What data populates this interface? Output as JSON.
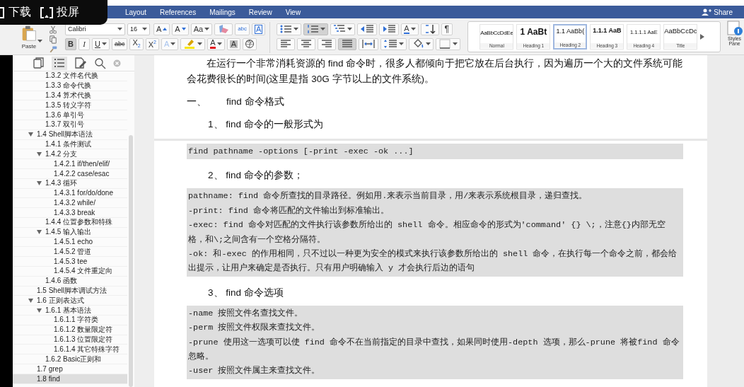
{
  "overlay": [
    {
      "kind": "download",
      "label": "下载"
    },
    {
      "kind": "cast",
      "label": "投屏"
    }
  ],
  "ribbon_tabs": [
    {
      "label": "Layout",
      "selected": false
    },
    {
      "label": "References",
      "selected": false
    },
    {
      "label": "Mailings",
      "selected": false
    },
    {
      "label": "Review",
      "selected": false
    },
    {
      "label": "View",
      "selected": false
    }
  ],
  "share": {
    "label": "Share"
  },
  "clipboard": {
    "paste_label": "Paste",
    "tools": [
      {
        "kind": "cut"
      },
      {
        "kind": "copy"
      },
      {
        "kind": "painter"
      }
    ]
  },
  "font": {
    "name": "Calibri",
    "size": "16",
    "row1": [
      {
        "kind": "grow",
        "label": "A",
        "on": false
      },
      {
        "kind": "shrink",
        "label": "A",
        "on": false
      },
      {
        "kind": "case",
        "label": "Aa",
        "on": false,
        "dropdown": true
      },
      {
        "kind": "clear",
        "on": false
      },
      {
        "kind": "spell",
        "label": "abc",
        "on": false
      },
      {
        "kind": "textbox",
        "label": "A",
        "on": false
      }
    ],
    "row2": [
      {
        "kind": "bold",
        "label": "B",
        "on": true
      },
      {
        "kind": "italic",
        "label": "I",
        "on": false
      },
      {
        "kind": "underline",
        "label": "U",
        "on": false,
        "dropdown": true
      },
      {
        "kind": "strike",
        "label": "abc",
        "on": false
      },
      {
        "kind": "sub",
        "label": "X$_{2}$",
        "on": false
      },
      {
        "kind": "sup",
        "label": "X$^{2}$",
        "on": false
      },
      {
        "kind": "effects",
        "label": "A",
        "on": false,
        "dropdown": true
      },
      {
        "kind": "highlight",
        "on": false,
        "dropdown": true
      },
      {
        "kind": "fontcolor",
        "label": "A",
        "on": false,
        "dropdown": true
      },
      {
        "kind": "shade",
        "label": "A",
        "on": false
      },
      {
        "kind": "enclose",
        "label": "字",
        "on": false
      }
    ]
  },
  "paragraph": {
    "row1": [
      {
        "kind": "bullets",
        "on": false,
        "dropdown": true
      },
      {
        "kind": "numbering",
        "on": true,
        "dropdown": true
      },
      {
        "kind": "multilevel",
        "on": false,
        "dropdown": true
      },
      {
        "kind": "outdent",
        "on": false
      },
      {
        "kind": "indent",
        "on": false
      },
      {
        "kind": "direction",
        "label": "A",
        "on": false,
        "dropdown": true
      },
      {
        "kind": "sort",
        "on": false
      },
      {
        "kind": "pilcrow",
        "label": "¶",
        "on": false
      }
    ],
    "row2": [
      {
        "kind": "left",
        "on": false
      },
      {
        "kind": "center",
        "on": false
      },
      {
        "kind": "right",
        "on": false
      },
      {
        "kind": "justify",
        "on": true
      },
      {
        "kind": "distribute",
        "on": false
      },
      {
        "kind": "spacing",
        "on": false,
        "dropdown": true
      },
      {
        "kind": "shading",
        "on": false,
        "dropdown": true
      },
      {
        "kind": "borders",
        "on": false,
        "dropdown": true
      }
    ]
  },
  "styles": [
    {
      "preview": "AaBbCcDdEe",
      "name": "Normal",
      "kind": "normal",
      "selected": false
    },
    {
      "preview": "1 AaBt",
      "name": "Heading 1",
      "kind": "h1",
      "selected": false
    },
    {
      "preview": "1.1 AaBb(",
      "name": "Heading 2",
      "kind": "h2",
      "selected": true
    },
    {
      "preview": "1.1.1 AaB",
      "name": "Heading 3",
      "kind": "h3",
      "selected": false
    },
    {
      "preview": "1.1.1.1 AaE",
      "name": "Heading 4",
      "kind": "h4",
      "selected": false
    },
    {
      "preview": "AaBbCcDc",
      "name": "Title",
      "kind": "title",
      "selected": false
    }
  ],
  "styles_pane": {
    "label": "Styles Pane"
  },
  "nav_pane": {
    "tabs": [
      {
        "kind": "thumbnails",
        "selected": false
      },
      {
        "kind": "outline",
        "selected": true
      },
      {
        "kind": "pages",
        "selected": false
      },
      {
        "kind": "search",
        "selected": false
      }
    ],
    "items": [
      {
        "children": [
          {
            "label": "1.3.2 文件名代换",
            "selected": false
          },
          {
            "label": "1.3.3 命令代换",
            "selected": false
          },
          {
            "label": "1.3.4 算术代换",
            "selected": false
          },
          {
            "label": "1.3.5 转义字符",
            "selected": false
          },
          {
            "label": "1.3.6 单引号",
            "selected": false
          },
          {
            "label": "1.3.7 双引号",
            "selected": false
          }
        ]
      },
      {
        "label": "1.4 Shell脚本语法",
        "selected": false,
        "expanded": true,
        "children": [
          {
            "label": "1.4.1 条件测试",
            "selected": false
          },
          {
            "label": "1.4.2 分支",
            "selected": false,
            "expanded": true,
            "children": [
              {
                "label": "1.4.2.1 if/then/elif/",
                "selected": false
              },
              {
                "label": "1.4.2.2 case/esac",
                "selected": false
              }
            ]
          },
          {
            "label": "1.4.3 循环",
            "selected": false,
            "expanded": true,
            "children": [
              {
                "label": "1.4.3.1 for/do/done",
                "selected": false
              },
              {
                "label": "1.4.3.2 while/",
                "selected": false
              },
              {
                "label": "1.4.3.3 break",
                "selected": false
              }
            ]
          },
          {
            "label": "1.4.4 位置参数和特殊",
            "selected": false
          },
          {
            "label": "1.4.5 输入输出",
            "selected": false,
            "expanded": true,
            "children": [
              {
                "label": "1.4.5.1 echo",
                "selected": false
              },
              {
                "label": "1.4.5.2 管道",
                "selected": false
              },
              {
                "label": "1.4.5.3 tee",
                "selected": false
              },
              {
                "label": "1.4.5.4 文件重定向",
                "selected": false
              }
            ]
          },
          {
            "label": "1.4.6 函数",
            "selected": false
          }
        ]
      },
      {
        "label": "1.5 Shell脚本调试方法",
        "selected": false
      },
      {
        "label": "1.6 正则表达式",
        "selected": false,
        "expanded": true,
        "children": [
          {
            "label": "1.6.1 基本语法",
            "selected": false,
            "expanded": true,
            "children": [
              {
                "label": "1.6.1.1 字符类",
                "selected": false
              },
              {
                "label": "1.6.1.2 数量限定符",
                "selected": false
              },
              {
                "label": "1.6.1.3 位置限定符",
                "selected": false
              },
              {
                "label": "1.6.1.4 其它特殊字符",
                "selected": false
              }
            ]
          },
          {
            "label": "1.6.2 Basic正则和",
            "selected": false
          }
        ]
      },
      {
        "label": "1.7 grep",
        "selected": false
      },
      {
        "label": "1.8 find",
        "selected": true
      }
    ]
  },
  "document": {
    "blocks": [
      {
        "kind": "para",
        "text": "在运行一个非常消耗资源的 find 命令时，很多人都倾向于把它放在后台执行，因为遍历一个大的文件系统可能会花费很长的时间(这里是指 30G 字节以上的文件系统)。"
      },
      {
        "kind": "heading1",
        "number": "一、",
        "text": "find  命令格式"
      },
      {
        "kind": "heading2",
        "text": "1、 find 命令的一般形式为"
      },
      {
        "kind": "page_break"
      },
      {
        "kind": "code",
        "lines": [
          "find pathname -options [-print -exec -ok ...]"
        ]
      },
      {
        "kind": "heading2",
        "text": "2、 find 命令的参数；"
      },
      {
        "kind": "code",
        "lines": [
          "pathname: find 命令所查找的目录路径。例如用.来表示当前目录，用/来表示系统根目录，递归查找。",
          "-print:  find 命令将匹配的文件输出到标准输出。",
          "-exec:  find 命令对匹配的文件执行该参数所给出的 shell 命令。相应命令的形式为'command' {} \\;，注意{}内部无空格，和\\;之间含有一个空格分隔符。",
          "-ok:  和-exec 的作用相同，只不过以一种更为安全的模式来执行该参数所给出的 shell 命令，在执行每一个命令之前，都会给出提示，让用户来确定是否执行。只有用户明确输入 y 才会执行后边的语句"
        ]
      },
      {
        "kind": "heading2",
        "text": "3、 find 命令选项"
      },
      {
        "kind": "code",
        "lines": [
          "-name 按照文件名查找文件。",
          "-perm 按照文件权限来查找文件。",
          "-prune 使用这一选项可以使 find 命令不在当前指定的目录中查找，如果同时使用-depth 选项，那么-prune 将被find 命令忽略。",
          "-user 按照文件属主来查找文件。"
        ]
      }
    ]
  }
}
